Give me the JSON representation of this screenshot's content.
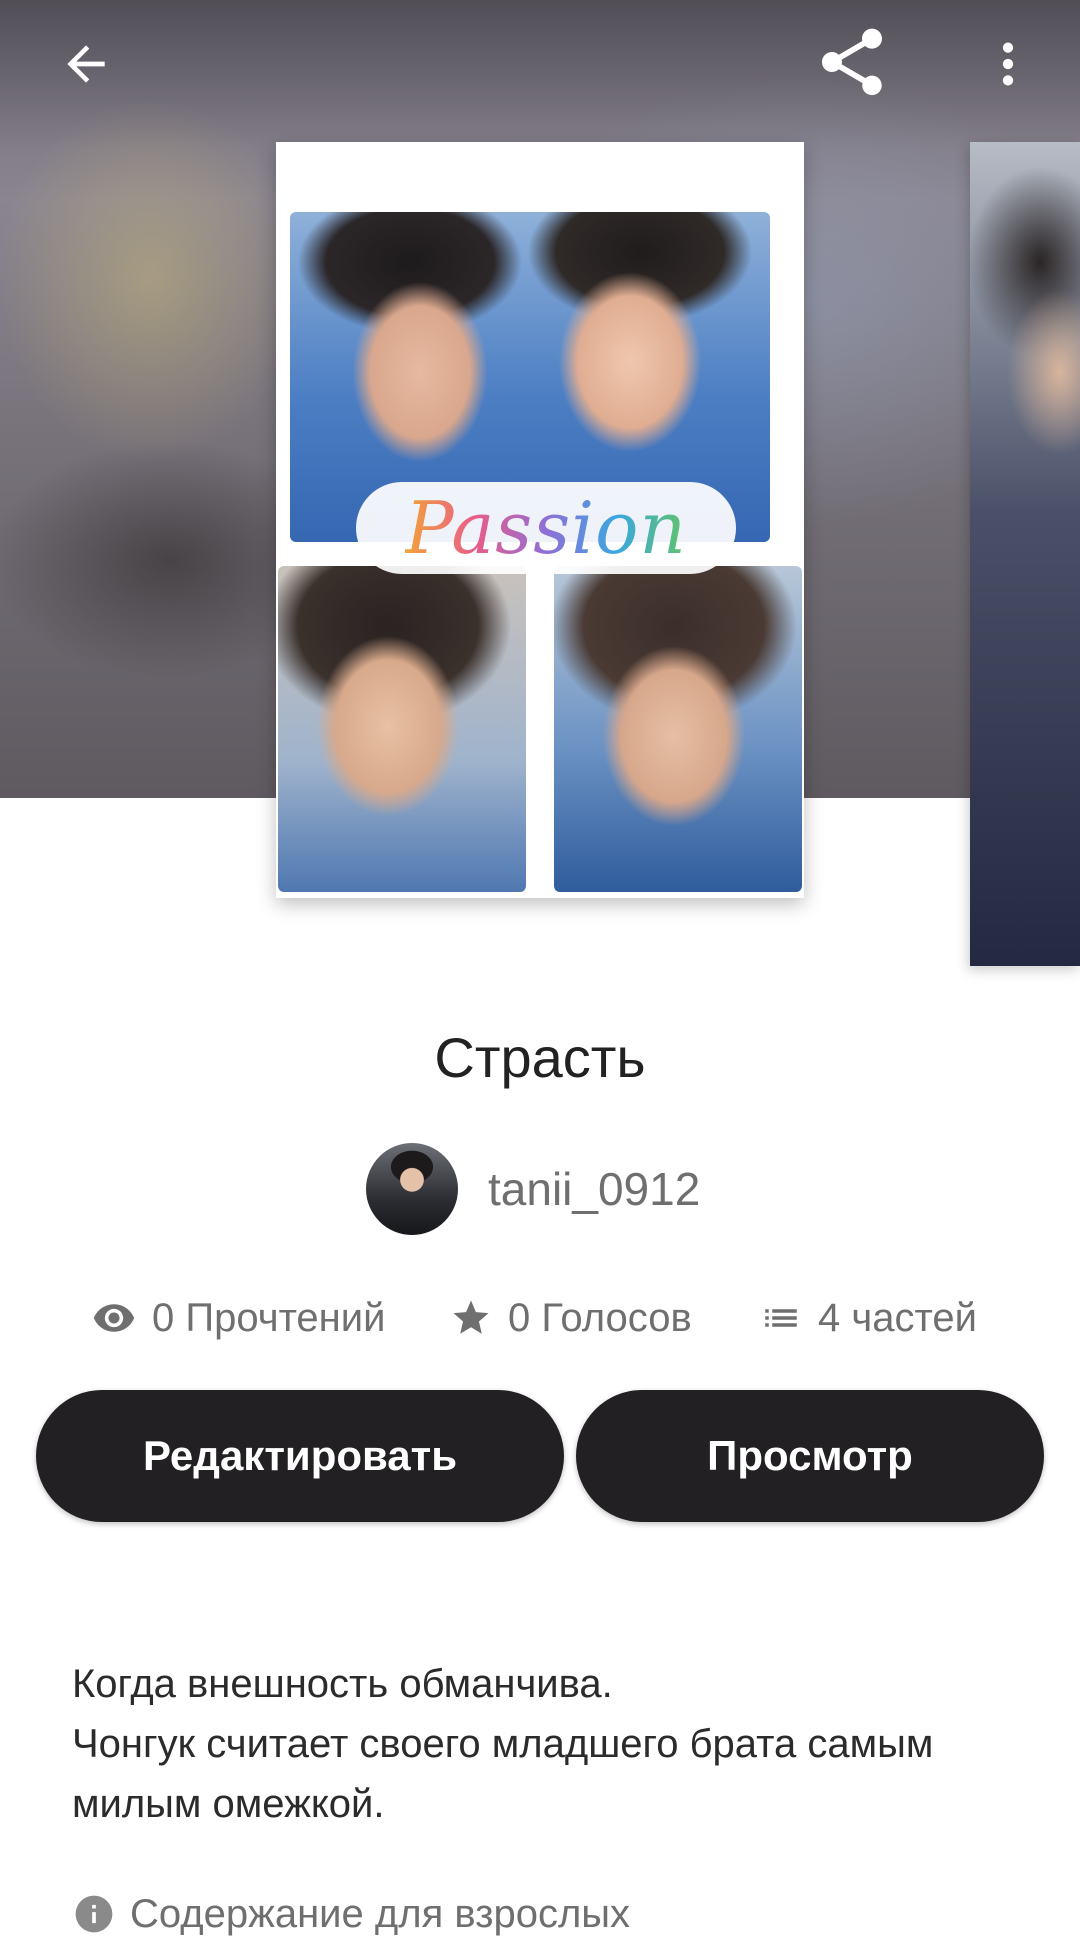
{
  "header": {
    "back_icon": "arrow-left-icon",
    "share_icon": "share-icon",
    "more_icon": "more-vertical-icon"
  },
  "cover": {
    "title_text": "Passion"
  },
  "story": {
    "title": "Страсть",
    "author": "tanii_0912"
  },
  "stats": {
    "reads": "0 Прочтений",
    "votes": "0 Голосов",
    "parts": "4 частей",
    "reads_icon": "eye-icon",
    "votes_icon": "star-icon",
    "parts_icon": "list-icon"
  },
  "actions": {
    "edit_label": "Редактировать",
    "view_label": "Просмотр"
  },
  "description": {
    "line1": "Когда внешность обманчива.",
    "line2": "Чонгук считает своего младшего брата самым милым омежкой."
  },
  "mature": {
    "label": "Содержание для взрослых",
    "icon": "info-icon"
  },
  "colors": {
    "button_bg": "#222022",
    "button_text": "#ffffff",
    "muted_text": "#6f6f6f"
  }
}
